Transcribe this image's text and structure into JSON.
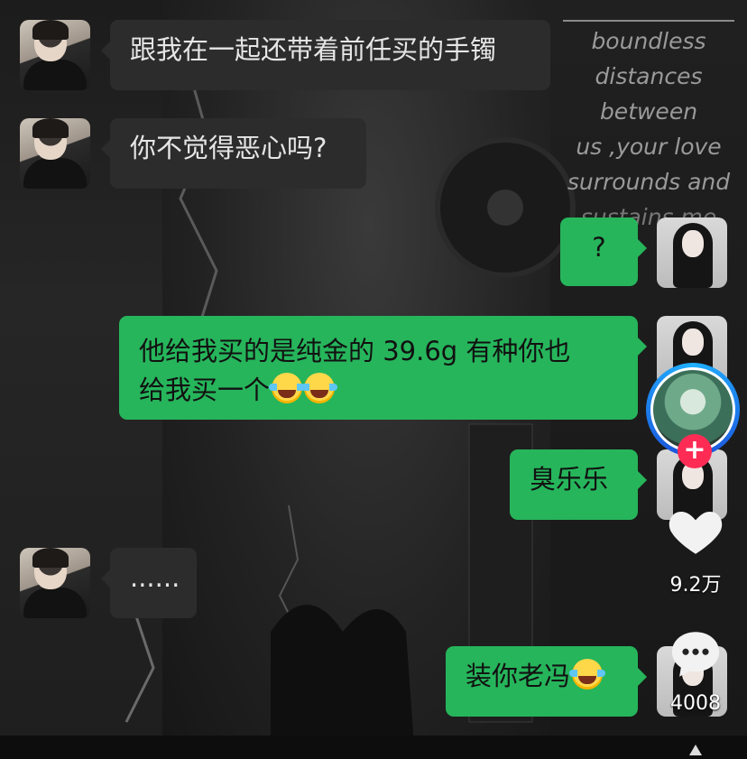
{
  "background_quote": [
    "boundless",
    "distances",
    "between",
    "us ,your love",
    "surrounds and",
    "sustains me"
  ],
  "messages": [
    {
      "side": "left",
      "text": "跟我在一起还带着前任买的手镯"
    },
    {
      "side": "left",
      "text": "你不觉得恶心吗?"
    },
    {
      "side": "right",
      "text": "?"
    },
    {
      "side": "right",
      "text_line1": "他给我买的是纯金的  39.6g  有种你也",
      "text_line2": "给我买一个"
    },
    {
      "side": "right",
      "text": "臭乐乐"
    },
    {
      "side": "left",
      "text": "......"
    },
    {
      "side": "right",
      "text": "装你老冯"
    }
  ],
  "emoji_icons": [
    "laughing-tears-emoji"
  ],
  "rail": {
    "follow_symbol": "+",
    "like_count": "9.2万",
    "comment_count": "4008"
  },
  "colors": {
    "right_bubble": "#26b55b",
    "left_bubble": "#2c2c2c",
    "follow_button": "#fe2c55",
    "ring": "#1fb0ff"
  }
}
